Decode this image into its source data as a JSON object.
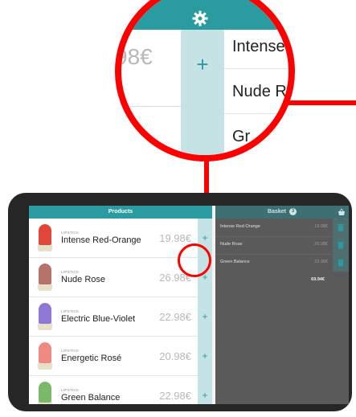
{
  "colors": {
    "accent": "#2a9ba1",
    "highlight": "#ff0000",
    "basket_bg": "#5a5a5a",
    "frame": "#262626"
  },
  "products_panel": {
    "title": "Products",
    "add_label": "+",
    "items": [
      {
        "category": "LIPSTICK",
        "name": "Intense Red-Orange",
        "price": "19.98€",
        "color": "#e0463a"
      },
      {
        "category": "LIPSTICK",
        "name": "Nude Rose",
        "price": "26.98€",
        "color": "#b5736b"
      },
      {
        "category": "LIPSTICK",
        "name": "Electric Blue-Violet",
        "price": "22.98€",
        "color": "#8f77d6"
      },
      {
        "category": "LIPSTICK",
        "name": "Energetic Rosé",
        "price": "20.98€",
        "color": "#ee8a83"
      },
      {
        "category": "LIPSTICK",
        "name": "Green Balance",
        "price": "22.98€",
        "color": "#7ab86a"
      }
    ]
  },
  "basket_panel": {
    "title": "Basket",
    "count": "3",
    "icon": "basket-icon",
    "items": [
      {
        "name": "Intense Red-Orange",
        "price": "19.98€"
      },
      {
        "name": "Nude Rose",
        "price": "26.98€"
      },
      {
        "name": "Green Balance",
        "price": "22.98€"
      }
    ],
    "total": "69.94€"
  },
  "magnifier": {
    "price_fragment": "98€",
    "add_label": "+",
    "names": [
      "Intense",
      "Nude R",
      "Gr"
    ],
    "icon": "gear-icon"
  }
}
